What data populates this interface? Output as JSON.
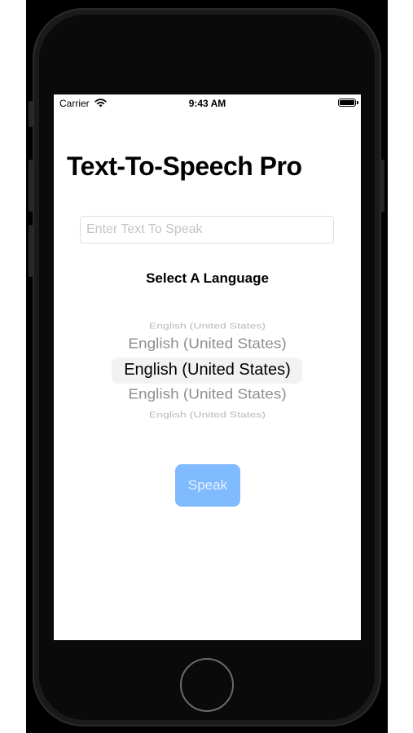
{
  "status_bar": {
    "carrier": "Carrier",
    "time": "9:43 AM",
    "wifi_icon": "wifi-icon",
    "battery_icon": "battery-icon"
  },
  "app": {
    "title": "Text-To-Speech Pro",
    "text_input": {
      "value": "",
      "placeholder": "Enter Text To Speak"
    },
    "language_label": "Select A Language",
    "language_picker": {
      "rows": [
        "English (United States)",
        "English (United States)",
        "English (United States)",
        "English (United States)",
        "English (United States)"
      ],
      "selected_value": "English (United States)"
    },
    "speak_label": "Speak"
  },
  "colors": {
    "speak_button_bg": "#80baff",
    "speak_button_text": "#e6f1ff",
    "picker_highlight": "#f2f2f4",
    "phone_frame": "#1a1a1a"
  }
}
